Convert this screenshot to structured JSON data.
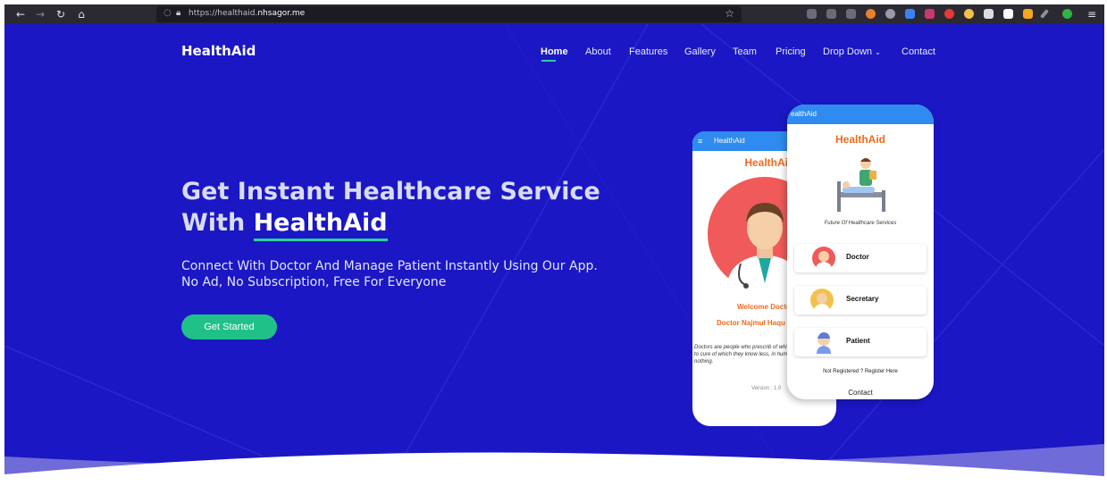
{
  "browser": {
    "url_prefix": "https://healthaid.",
    "url_domain": "nhsagor.me"
  },
  "site": {
    "brand": "HealthAid",
    "nav": {
      "home": "Home",
      "about": "About",
      "features": "Features",
      "gallery": "Gallery",
      "team": "Team",
      "pricing": "Pricing",
      "dropdown": "Drop Down",
      "contact": "Contact"
    }
  },
  "hero": {
    "headline_part1": "Get Instant Healthcare Service With ",
    "headline_brand": "HealthAid",
    "subline": "Connect With Doctor And Manage Patient Instantly Using Our App. No Ad, No Subscription, Free For Everyone",
    "cta": "Get Started"
  },
  "phone_back": {
    "appbar": "HealthAid",
    "title": "HealthAic",
    "welcome": "Welcome Docto",
    "doctor_name": "Doctor Najmul Haqu",
    "quote": "Doctors are people who prescrib of which they know little, to cure of which they know less, in hum whom they know nothing.",
    "version": "Version : 1.0"
  },
  "phone_front": {
    "appbar": "ealthAid",
    "title": "HealthAid",
    "tagline": "Future Of Healthcare Services",
    "roles": {
      "doctor": "Doctor",
      "secretary": "Secretary",
      "patient": "Patient"
    },
    "register": "Not Registered ? Register Here",
    "contact": "Contact"
  },
  "colors": {
    "hero_bg": "#1b17c4",
    "accent_green": "#1fc188",
    "app_blue": "#2f8bef",
    "app_orange": "#f06a1d"
  }
}
